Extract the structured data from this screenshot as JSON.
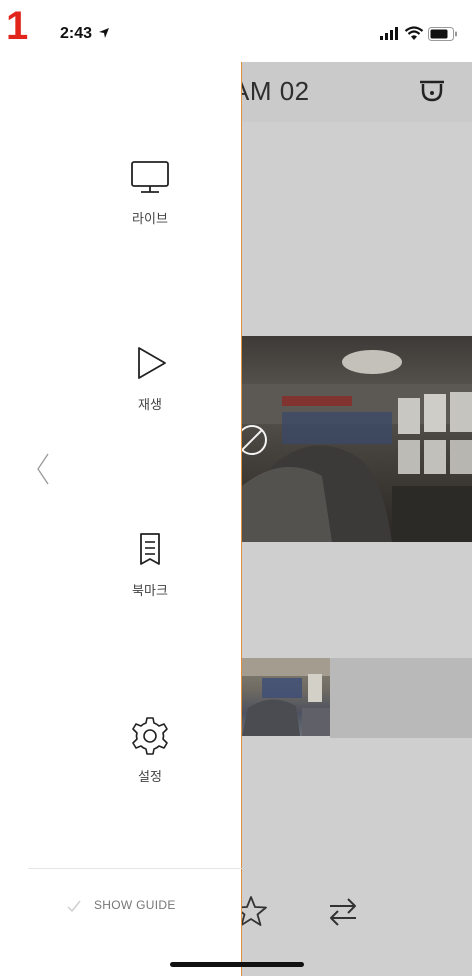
{
  "step_number": "1",
  "status_bar": {
    "time": "2:43",
    "location_icon": "location-arrow-icon",
    "signal_icon": "cellular-signal-icon",
    "wifi_icon": "wifi-icon",
    "battery_icon": "battery-icon"
  },
  "background_app": {
    "title": "AM 02",
    "header_icon": "dome-camera-icon",
    "bottom_icons": [
      "star-icon",
      "swap-icon"
    ]
  },
  "drawer": {
    "back_icon": "chevron-left-icon",
    "items": [
      {
        "label": "라이브",
        "icon": "monitor-icon"
      },
      {
        "label": "재생",
        "icon": "play-icon"
      },
      {
        "label": "북마크",
        "icon": "bookmark-icon"
      },
      {
        "label": "설정",
        "icon": "gear-icon"
      }
    ],
    "show_guide": {
      "label": "SHOW GUIDE",
      "icon": "checkmark-icon"
    }
  },
  "colors": {
    "step_number": "#e1251b",
    "drawer_border": "#e0903a",
    "background_app": "#cfcfcf"
  }
}
